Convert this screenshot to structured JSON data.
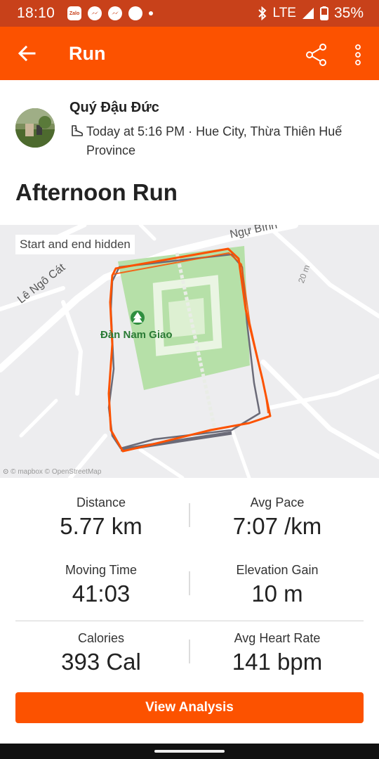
{
  "status_bar": {
    "time": "18:10",
    "zalo_label": "Zalo",
    "network": "LTE",
    "battery": "35%",
    "icons": [
      "zalo-icon",
      "messenger-icon",
      "messenger-icon",
      "circle-icon",
      "dot-icon",
      "bluetooth-icon",
      "signal-icon",
      "battery-icon"
    ]
  },
  "app_bar": {
    "title": "Run",
    "icons": [
      "back-arrow-icon",
      "share-icon",
      "more-vert-icon"
    ]
  },
  "athlete": {
    "name": "Quý Đậu Đức",
    "when_where": "Today at 5:16 PM · Hue City, Thừa Thiên Huế Province",
    "activity_icon": "shoe-icon"
  },
  "activity": {
    "title": "Afternoon Run"
  },
  "map": {
    "privacy_label": "Start and end hidden",
    "place_label": "Đàn Nam Giao",
    "street_1": "Lê Ngô Cát",
    "street_2": "Ngự Bình",
    "contour_label": "20 m",
    "attribution": "© mapbox © OpenStreetMap",
    "route_color": "#fc5200",
    "route_lap_color": "#6b6b78",
    "park_color": "#b6e0a8"
  },
  "stats": {
    "distance": {
      "label": "Distance",
      "value": "5.77 km"
    },
    "avg_pace": {
      "label": "Avg Pace",
      "value": "7:07 /km"
    },
    "moving_time": {
      "label": "Moving Time",
      "value": "41:03"
    },
    "elevation_gain": {
      "label": "Elevation Gain",
      "value": "10 m"
    },
    "calories": {
      "label": "Calories",
      "value": "393 Cal"
    },
    "avg_heart_rate": {
      "label": "Avg Heart Rate",
      "value": "141 bpm"
    }
  },
  "actions": {
    "view_analysis": "View Analysis"
  },
  "colors": {
    "brand": "#fc5200",
    "status_bar": "#c8411a"
  }
}
